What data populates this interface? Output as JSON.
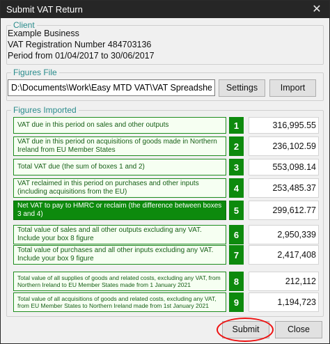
{
  "window": {
    "title": "Submit VAT Return",
    "close_glyph": "✕"
  },
  "client": {
    "legend": "Client",
    "name": "Example Business",
    "vat_reg": "VAT Registration Number 484703136",
    "period": "Period from 01/04/2017 to 30/06/2017"
  },
  "figures_file": {
    "legend": "Figures File",
    "path": "D:\\Documents\\Work\\Easy MTD VAT\\VAT Spreadsheet",
    "settings_label": "Settings",
    "import_label": "Import"
  },
  "figures": {
    "legend": "Figures Imported",
    "rows": [
      {
        "label": "VAT due in this period on sales and other outputs",
        "box": "1",
        "value": "316,995.55"
      },
      {
        "label": "VAT due in this period on acquisitions of goods made in Northern Ireland from EU Member States",
        "box": "2",
        "value": "236,102.59"
      },
      {
        "label": "Total VAT due (the sum of boxes 1 and 2)",
        "box": "3",
        "value": "553,098.14"
      },
      {
        "label": "VAT reclaimed in this period on purchases and other inputs (including acquisitions from the EU)",
        "box": "4",
        "value": "253,485.37"
      },
      {
        "label": "Net VAT to pay to HMRC or reclaim (the difference between boxes 3 and 4)",
        "box": "5",
        "value": "299,612.77"
      },
      {
        "label": "Total value of sales and all other outputs excluding any VAT. Include your box 8 figure",
        "box": "6",
        "value": "2,950,339"
      },
      {
        "label": "Total value of purchases and all other inputs excluding any VAT. Include your box 9 figure",
        "box": "7",
        "value": "2,417,408"
      },
      {
        "label": "Total value of all supplies of goods and related costs, excluding any VAT, from Northern Ireland to EU Member States made from 1 January 2021",
        "box": "8",
        "value": "212,112"
      },
      {
        "label": "Total value of all acquisitions of goods and related costs, excluding any VAT, from EU Member States to Northern Ireland made from 1st January 2021",
        "box": "9",
        "value": "1,194,723"
      }
    ]
  },
  "footer": {
    "submit_label": "Submit",
    "close_label": "Close"
  },
  "colors": {
    "accent_green": "#0d8a0d",
    "legend_teal": "#2a8c8c",
    "highlight_ring": "#e11111"
  }
}
